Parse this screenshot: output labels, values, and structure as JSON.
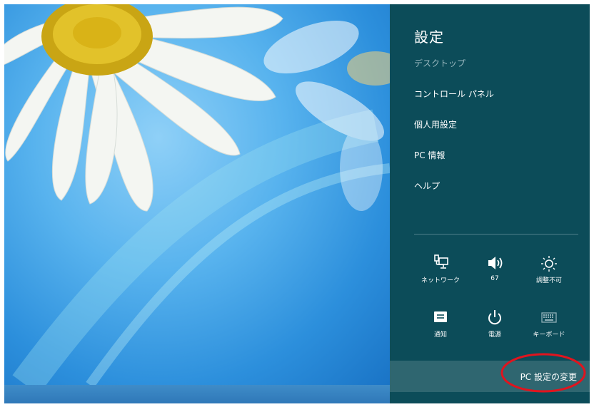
{
  "charm": {
    "title": "設定",
    "items": [
      {
        "label": "デスクトップ"
      },
      {
        "label": "コントロール パネル"
      },
      {
        "label": "個人用設定"
      },
      {
        "label": "PC 情報"
      },
      {
        "label": "ヘルプ"
      }
    ],
    "quick_settings": [
      {
        "label": "ネットワーク",
        "icon": "network-icon"
      },
      {
        "label": "67",
        "icon": "volume-icon"
      },
      {
        "label": "調整不可",
        "icon": "brightness-icon"
      },
      {
        "label": "通知",
        "icon": "notifications-icon"
      },
      {
        "label": "電源",
        "icon": "power-icon"
      },
      {
        "label": "キーボード",
        "icon": "keyboard-icon"
      }
    ],
    "change_settings": "PC 設定の変更"
  },
  "colors": {
    "charm_background": "#0c4c59",
    "change_bar": "#2f6670",
    "highlight": "#e0141e"
  }
}
